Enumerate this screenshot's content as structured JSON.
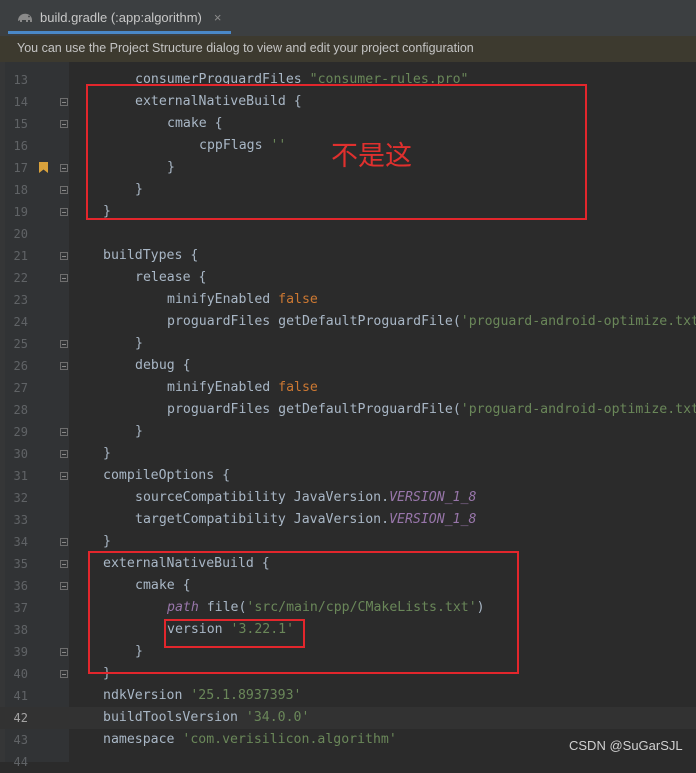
{
  "tab": {
    "title": "build.gradle (:app:algorithm)",
    "close": "×"
  },
  "banner": {
    "message": "You can use the Project Structure dialog to view and edit your project configuration"
  },
  "annotation": {
    "text": "不是这",
    "color": "#e3262c"
  },
  "watermark": {
    "text": "CSDN @SuGarSJL"
  },
  "editor": {
    "lines": [
      {
        "n": "13",
        "indent": 4,
        "parts": [
          {
            "t": "consumerProguardFiles ",
            "c": "p"
          },
          {
            "t": "\"consumer-rules.pro\"",
            "c": "s"
          }
        ]
      },
      {
        "n": "14",
        "indent": 4,
        "fold": true,
        "parts": [
          {
            "t": "externalNativeBuild {",
            "c": "p"
          }
        ]
      },
      {
        "n": "15",
        "indent": 6,
        "fold": true,
        "parts": [
          {
            "t": "cmake {",
            "c": "p"
          }
        ]
      },
      {
        "n": "16",
        "indent": 8,
        "parts": [
          {
            "t": "cppFlags ",
            "c": "p"
          },
          {
            "t": "''",
            "c": "s"
          }
        ]
      },
      {
        "n": "17",
        "indent": 6,
        "fold": true,
        "bookmark": true,
        "parts": [
          {
            "t": "}",
            "c": "p"
          }
        ]
      },
      {
        "n": "18",
        "indent": 4,
        "fold": true,
        "parts": [
          {
            "t": "}",
            "c": "p"
          }
        ]
      },
      {
        "n": "19",
        "indent": 2,
        "fold": true,
        "parts": [
          {
            "t": "}",
            "c": "p"
          }
        ]
      },
      {
        "n": "20",
        "indent": 0,
        "parts": []
      },
      {
        "n": "21",
        "indent": 2,
        "fold": true,
        "parts": [
          {
            "t": "buildTypes {",
            "c": "p"
          }
        ]
      },
      {
        "n": "22",
        "indent": 4,
        "fold": true,
        "parts": [
          {
            "t": "release {",
            "c": "p"
          }
        ]
      },
      {
        "n": "23",
        "indent": 6,
        "parts": [
          {
            "t": "minifyEnabled ",
            "c": "p"
          },
          {
            "t": "false",
            "c": "k"
          }
        ]
      },
      {
        "n": "24",
        "indent": 6,
        "parts": [
          {
            "t": "proguardFiles getDefaultProguardFile(",
            "c": "p"
          },
          {
            "t": "'proguard-android-optimize.txt'",
            "c": "s"
          }
        ]
      },
      {
        "n": "25",
        "indent": 4,
        "fold": true,
        "parts": [
          {
            "t": "}",
            "c": "p"
          }
        ]
      },
      {
        "n": "26",
        "indent": 4,
        "fold": true,
        "parts": [
          {
            "t": "debug {",
            "c": "p"
          }
        ]
      },
      {
        "n": "27",
        "indent": 6,
        "parts": [
          {
            "t": "minifyEnabled ",
            "c": "p"
          },
          {
            "t": "false",
            "c": "k"
          }
        ]
      },
      {
        "n": "28",
        "indent": 6,
        "parts": [
          {
            "t": "proguardFiles getDefaultProguardFile(",
            "c": "p"
          },
          {
            "t": "'proguard-android-optimize.txt'",
            "c": "s"
          }
        ]
      },
      {
        "n": "29",
        "indent": 4,
        "fold": true,
        "parts": [
          {
            "t": "}",
            "c": "p"
          }
        ]
      },
      {
        "n": "30",
        "indent": 2,
        "fold": true,
        "parts": [
          {
            "t": "}",
            "c": "p"
          }
        ]
      },
      {
        "n": "31",
        "indent": 2,
        "fold": true,
        "parts": [
          {
            "t": "compileOptions {",
            "c": "p"
          }
        ]
      },
      {
        "n": "32",
        "indent": 4,
        "parts": [
          {
            "t": "sourceCompatibility JavaVersion.",
            "c": "p"
          },
          {
            "t": "VERSION_1_8",
            "c": "i"
          }
        ]
      },
      {
        "n": "33",
        "indent": 4,
        "parts": [
          {
            "t": "targetCompatibility JavaVersion.",
            "c": "p"
          },
          {
            "t": "VERSION_1_8",
            "c": "i"
          }
        ]
      },
      {
        "n": "34",
        "indent": 2,
        "fold": true,
        "parts": [
          {
            "t": "}",
            "c": "p"
          }
        ]
      },
      {
        "n": "35",
        "indent": 2,
        "fold": true,
        "parts": [
          {
            "t": "externalNativeBuild {",
            "c": "p"
          }
        ]
      },
      {
        "n": "36",
        "indent": 4,
        "fold": true,
        "parts": [
          {
            "t": "cmake {",
            "c": "p"
          }
        ]
      },
      {
        "n": "37",
        "indent": 6,
        "parts": [
          {
            "t": "path",
            "c": "i"
          },
          {
            "t": " file(",
            "c": "p"
          },
          {
            "t": "'src/main/cpp/CMakeLists.txt'",
            "c": "s"
          },
          {
            "t": ")",
            "c": "p"
          }
        ]
      },
      {
        "n": "38",
        "indent": 6,
        "parts": [
          {
            "t": "version ",
            "c": "p"
          },
          {
            "t": "'3.22.1'",
            "c": "s"
          }
        ]
      },
      {
        "n": "39",
        "indent": 4,
        "fold": true,
        "parts": [
          {
            "t": "}",
            "c": "p"
          }
        ]
      },
      {
        "n": "40",
        "indent": 2,
        "fold": true,
        "parts": [
          {
            "t": "}",
            "c": "p"
          }
        ]
      },
      {
        "n": "41",
        "indent": 2,
        "parts": [
          {
            "t": "ndkVersion ",
            "c": "p"
          },
          {
            "t": "'25.1.8937393'",
            "c": "s"
          }
        ]
      },
      {
        "n": "42",
        "indent": 2,
        "current": true,
        "parts": [
          {
            "t": "buildToolsVersion ",
            "c": "p"
          },
          {
            "t": "'34.0.0'",
            "c": "s"
          }
        ]
      },
      {
        "n": "43",
        "indent": 2,
        "parts": [
          {
            "t": "namespace ",
            "c": "p"
          },
          {
            "t": "'com.verisilicon.algorithm'",
            "c": "s"
          }
        ]
      },
      {
        "n": "44",
        "indent": 0,
        "parts": []
      }
    ]
  }
}
